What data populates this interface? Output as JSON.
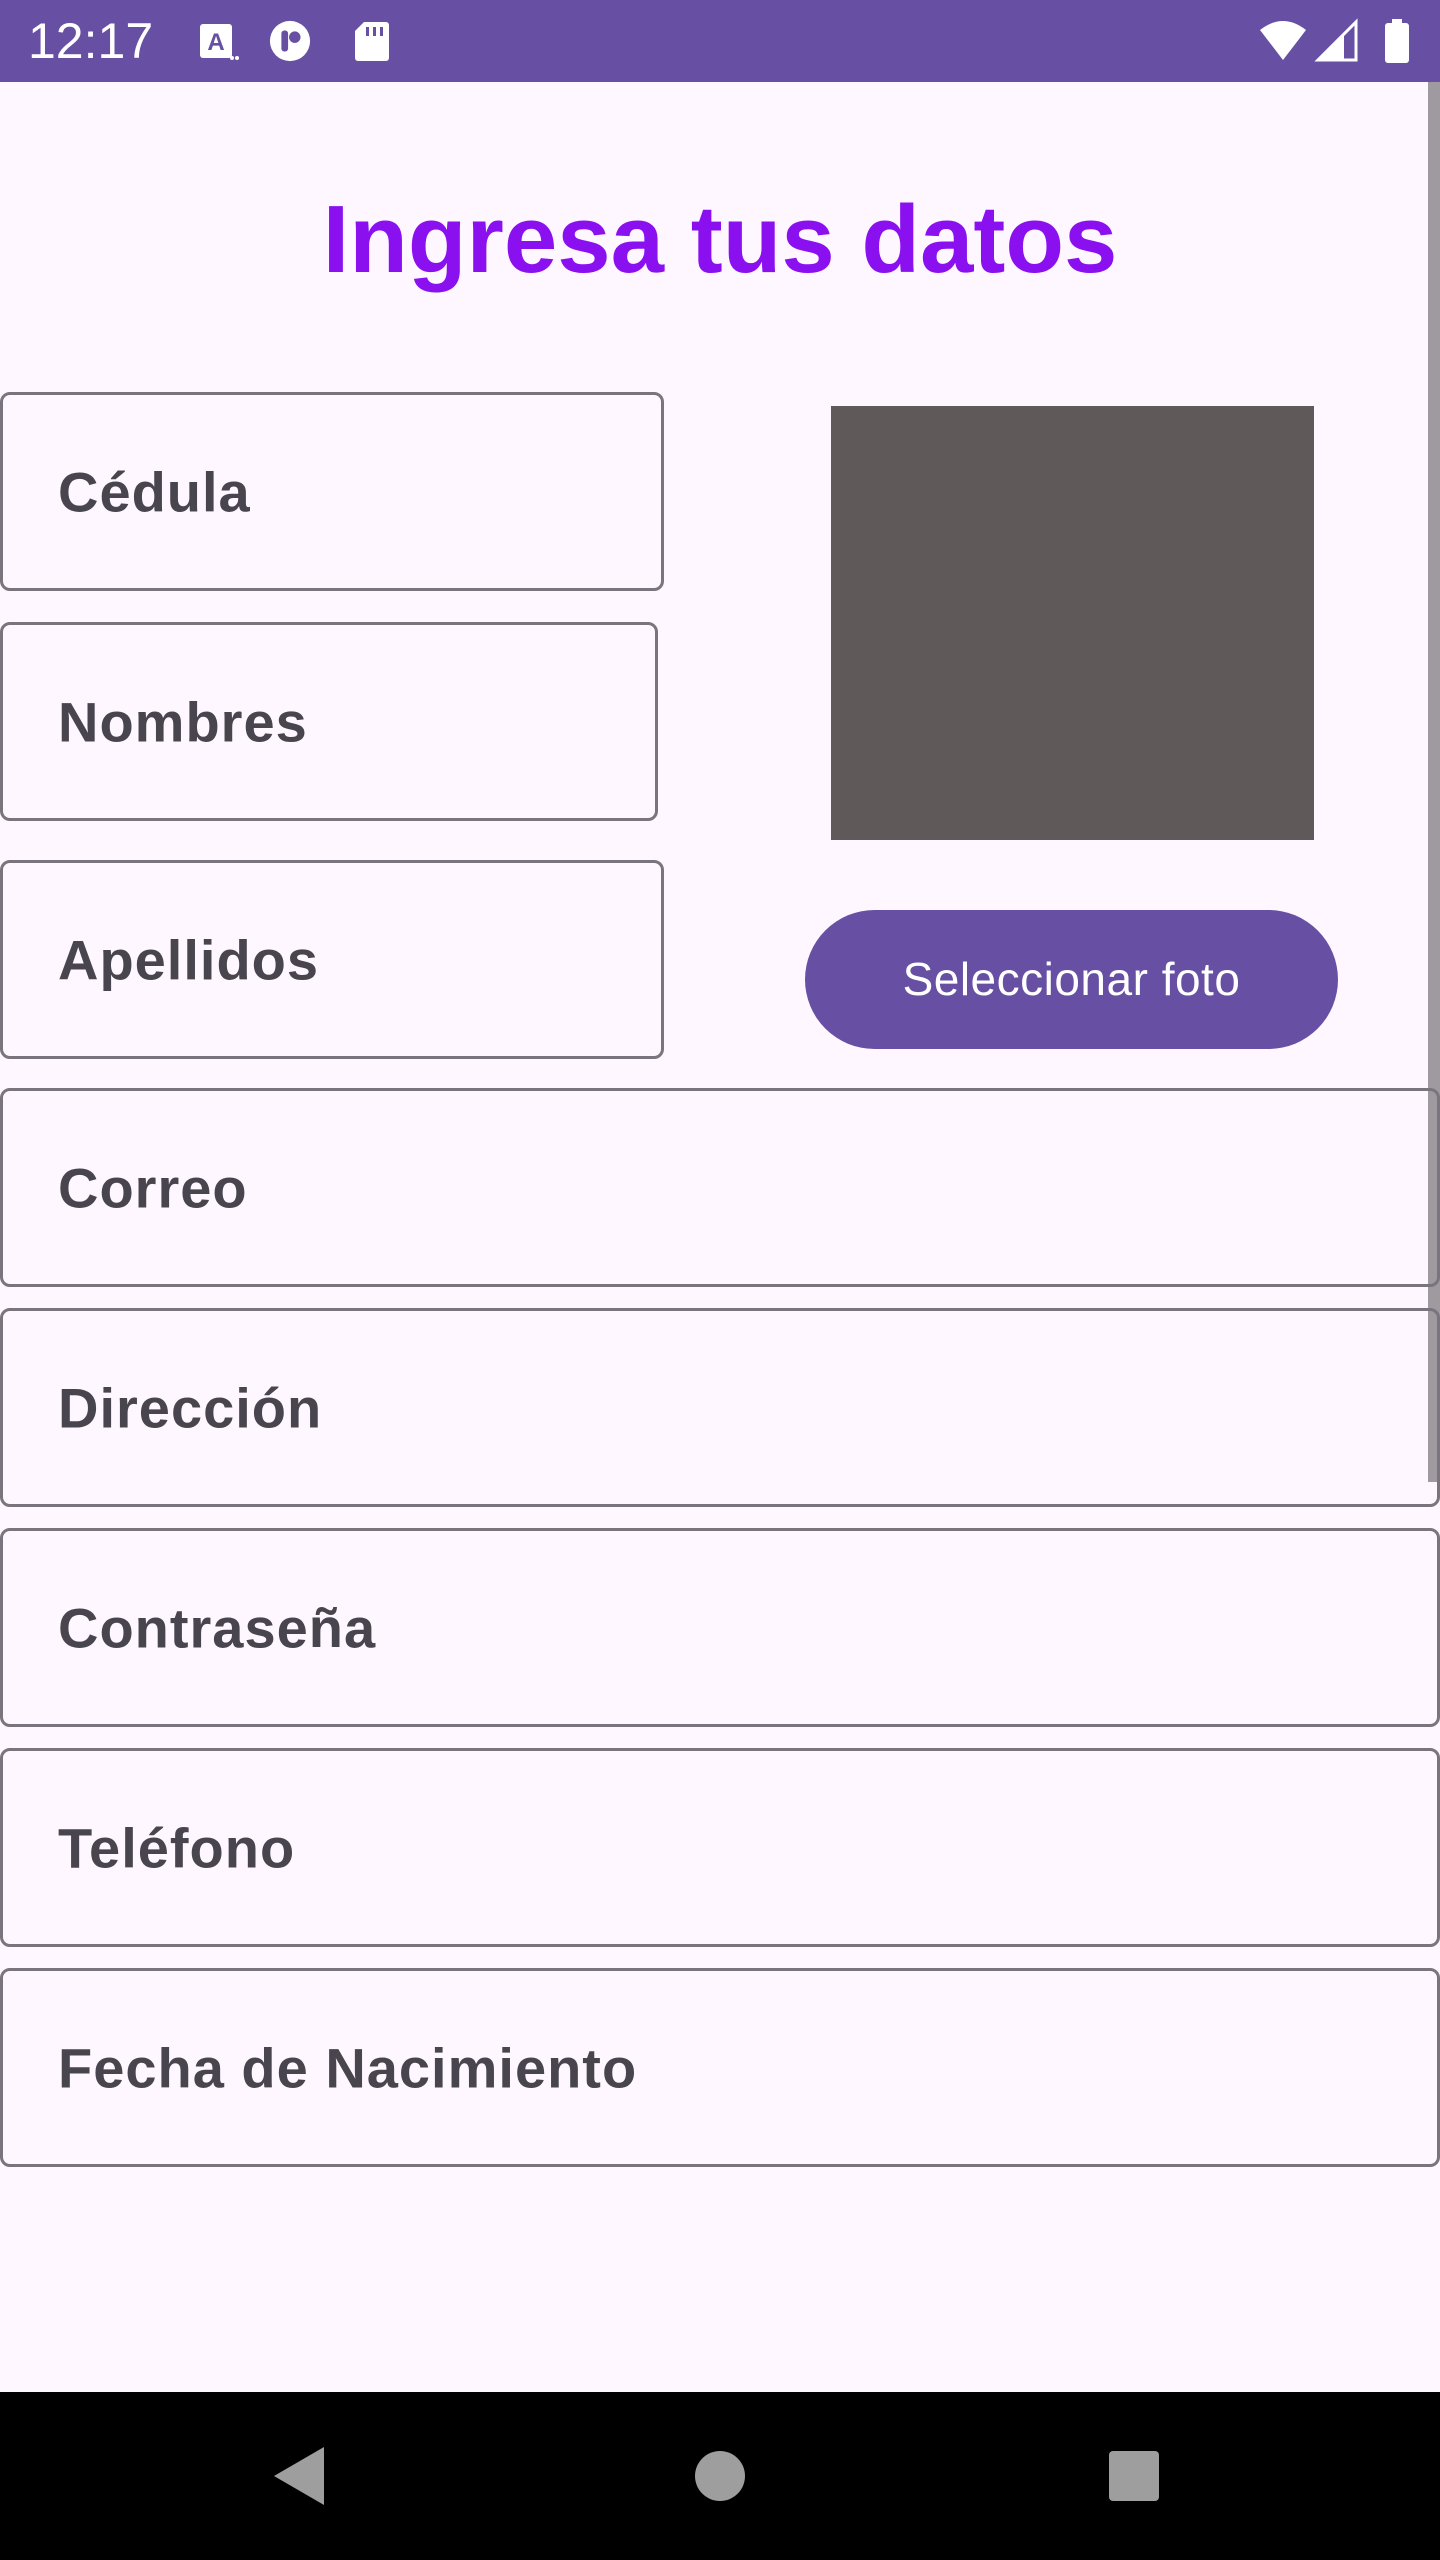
{
  "status_bar": {
    "time": "12:17",
    "background": "#6750A4",
    "icons": [
      "translate-notification-icon",
      "app-notification-icon",
      "sd-card-icon",
      "wifi-icon",
      "signal-icon",
      "battery-icon"
    ]
  },
  "form": {
    "title": "Ingresa tus datos",
    "title_color": "#8A10F0",
    "fields": {
      "cedula": "Cédula",
      "nombres": "Nombres",
      "apellidos": "Apellidos",
      "correo": "Correo",
      "direccion": "Dirección",
      "contrasena": "Contraseña",
      "telefono": "Teléfono",
      "fecha_nacimiento": "Fecha de Nacimiento"
    },
    "select_photo_label": "Seleccionar foto",
    "accent": "#6750A4"
  },
  "navigation": {
    "buttons": [
      "back-icon",
      "home-icon",
      "recents-icon"
    ]
  }
}
